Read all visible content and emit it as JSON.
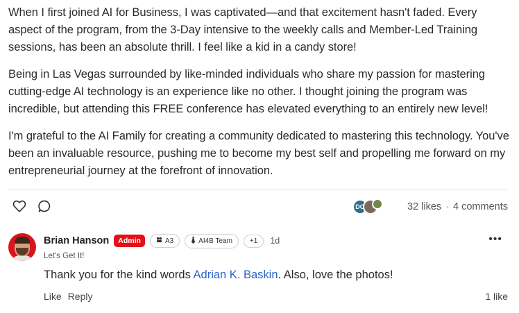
{
  "post": {
    "paragraphs": [
      "When I first joined AI for Business, I was captivated—and that excitement hasn't faded. Every aspect of the program, from the 3-Day intensive to the weekly calls and Member-Led Training sessions, has been an absolute thrill. I feel like a kid in a candy store!",
      "Being in Las Vegas surrounded by like-minded individuals who share my passion for mastering cutting-edge AI technology is an experience like no other. I thought joining the program was incredible, but attending this FREE conference has elevated everything to an entirely new level!",
      "I'm grateful to the AI Family for creating a community dedicated to mastering this technology. You've been an invaluable resource, pushing me to become my best self and propelling me forward on my entrepreneurial journey at the forefront of innovation."
    ]
  },
  "engagement": {
    "liker_initials": "DO",
    "likes": "32 likes",
    "separator": "·",
    "comments": "4 comments"
  },
  "comment": {
    "author": "Brian Hanson",
    "role_badge": "Admin",
    "chips": [
      "A3",
      "AI4B Team",
      "+1"
    ],
    "time": "1d",
    "subtitle": "Let's Get It!",
    "text_before": "Thank you for the kind words ",
    "mention": "Adrian K. Baskin",
    "text_after": ". Also, love the photos!",
    "like_label": "Like",
    "reply_label": "Reply",
    "likes": "1 like",
    "more": "•••"
  },
  "icons": {
    "like": "heart-icon",
    "comment": "comment-bubble-icon",
    "chip_a3": "group-icon",
    "chip_team": "tie-icon",
    "more": "more-icon"
  },
  "colors": {
    "admin_badge": "#e51017",
    "mention": "#2a63c9",
    "avatar_bg": "#d8141f"
  }
}
